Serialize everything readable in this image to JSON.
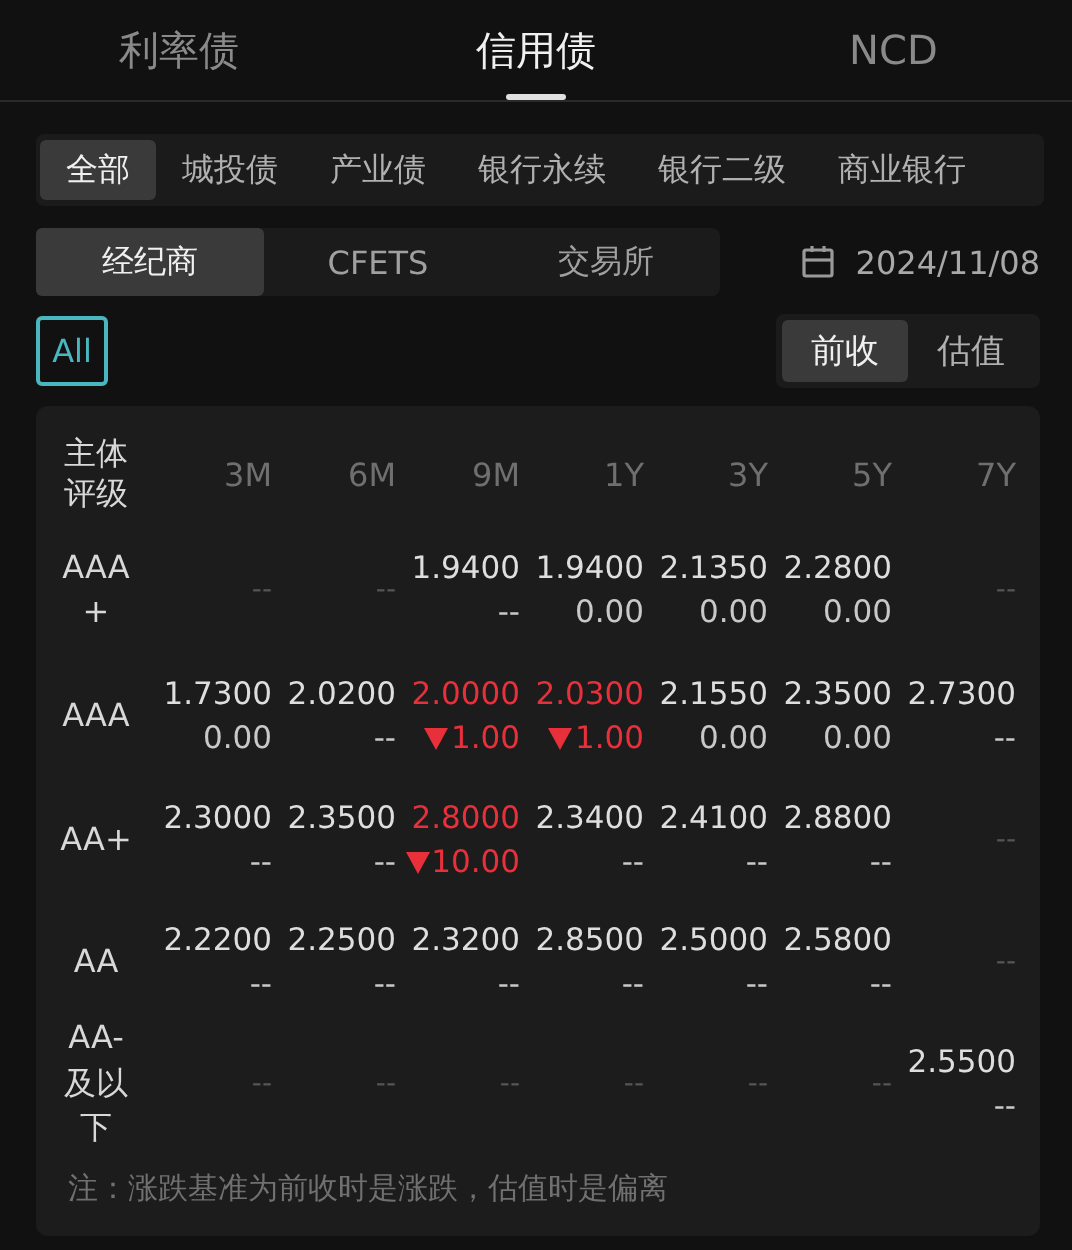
{
  "tabs": [
    {
      "label": "利率债",
      "selected": false
    },
    {
      "label": "信用债",
      "selected": true
    },
    {
      "label": "NCD",
      "selected": false
    }
  ],
  "categories": [
    {
      "label": "全部",
      "selected": true
    },
    {
      "label": "城投债",
      "selected": false
    },
    {
      "label": "产业债",
      "selected": false
    },
    {
      "label": "银行永续",
      "selected": false
    },
    {
      "label": "银行二级",
      "selected": false
    },
    {
      "label": "商业银行",
      "selected": false
    }
  ],
  "sources": [
    {
      "label": "经纪商",
      "selected": true
    },
    {
      "label": "CFETS",
      "selected": false
    },
    {
      "label": "交易所",
      "selected": false
    }
  ],
  "date": "2024/11/08",
  "all_button": {
    "label": "All",
    "selected": true
  },
  "basis": [
    {
      "label": "前收",
      "selected": true
    },
    {
      "label": "估值",
      "selected": false
    }
  ],
  "table": {
    "corner": "主体评级",
    "columns": [
      "3M",
      "6M",
      "9M",
      "1Y",
      "3Y",
      "5Y",
      "7Y"
    ],
    "rows": [
      {
        "rating": "AAA+",
        "cells": [
          {
            "kind": "empty",
            "text": "--"
          },
          {
            "kind": "empty",
            "text": "--"
          },
          {
            "kind": "quote",
            "value": "1.9400",
            "change": "--",
            "falling": false
          },
          {
            "kind": "quote",
            "value": "1.9400",
            "change": "0.00",
            "falling": false
          },
          {
            "kind": "quote",
            "value": "2.1350",
            "change": "0.00",
            "falling": false
          },
          {
            "kind": "quote",
            "value": "2.2800",
            "change": "0.00",
            "falling": false
          },
          {
            "kind": "empty",
            "text": "--"
          }
        ]
      },
      {
        "rating": "AAA",
        "cells": [
          {
            "kind": "quote",
            "value": "1.7300",
            "change": "0.00",
            "falling": false
          },
          {
            "kind": "quote",
            "value": "2.0200",
            "change": "--",
            "falling": false
          },
          {
            "kind": "quote",
            "value": "2.0000",
            "change": "1.00",
            "falling": true
          },
          {
            "kind": "quote",
            "value": "2.0300",
            "change": "1.00",
            "falling": true
          },
          {
            "kind": "quote",
            "value": "2.1550",
            "change": "0.00",
            "falling": false
          },
          {
            "kind": "quote",
            "value": "2.3500",
            "change": "0.00",
            "falling": false
          },
          {
            "kind": "quote",
            "value": "2.7300",
            "change": "--",
            "falling": false
          }
        ]
      },
      {
        "rating": "AA+",
        "cells": [
          {
            "kind": "quote",
            "value": "2.3000",
            "change": "--",
            "falling": false
          },
          {
            "kind": "quote",
            "value": "2.3500",
            "change": "--",
            "falling": false
          },
          {
            "kind": "quote",
            "value": "2.8000",
            "change": "10.00",
            "falling": true
          },
          {
            "kind": "quote",
            "value": "2.3400",
            "change": "--",
            "falling": false
          },
          {
            "kind": "quote",
            "value": "2.4100",
            "change": "--",
            "falling": false
          },
          {
            "kind": "quote",
            "value": "2.8800",
            "change": "--",
            "falling": false
          },
          {
            "kind": "empty",
            "text": "--"
          }
        ]
      },
      {
        "rating": "AA",
        "cells": [
          {
            "kind": "quote",
            "value": "2.2200",
            "change": "--",
            "falling": false
          },
          {
            "kind": "quote",
            "value": "2.2500",
            "change": "--",
            "falling": false
          },
          {
            "kind": "quote",
            "value": "2.3200",
            "change": "--",
            "falling": false
          },
          {
            "kind": "quote",
            "value": "2.8500",
            "change": "--",
            "falling": false
          },
          {
            "kind": "quote",
            "value": "2.5000",
            "change": "--",
            "falling": false
          },
          {
            "kind": "quote",
            "value": "2.5800",
            "change": "--",
            "falling": false
          },
          {
            "kind": "empty",
            "text": "--"
          }
        ]
      },
      {
        "rating": "AA-及以下",
        "cells": [
          {
            "kind": "empty",
            "text": "--"
          },
          {
            "kind": "empty",
            "text": "--"
          },
          {
            "kind": "empty",
            "text": "--"
          },
          {
            "kind": "empty",
            "text": "--"
          },
          {
            "kind": "empty",
            "text": "--"
          },
          {
            "kind": "empty",
            "text": "--"
          },
          {
            "kind": "quote",
            "value": "2.5500",
            "change": "--",
            "falling": false
          }
        ]
      }
    ]
  },
  "note": "注：涨跌基准为前收时是涨跌，估值时是偏离"
}
